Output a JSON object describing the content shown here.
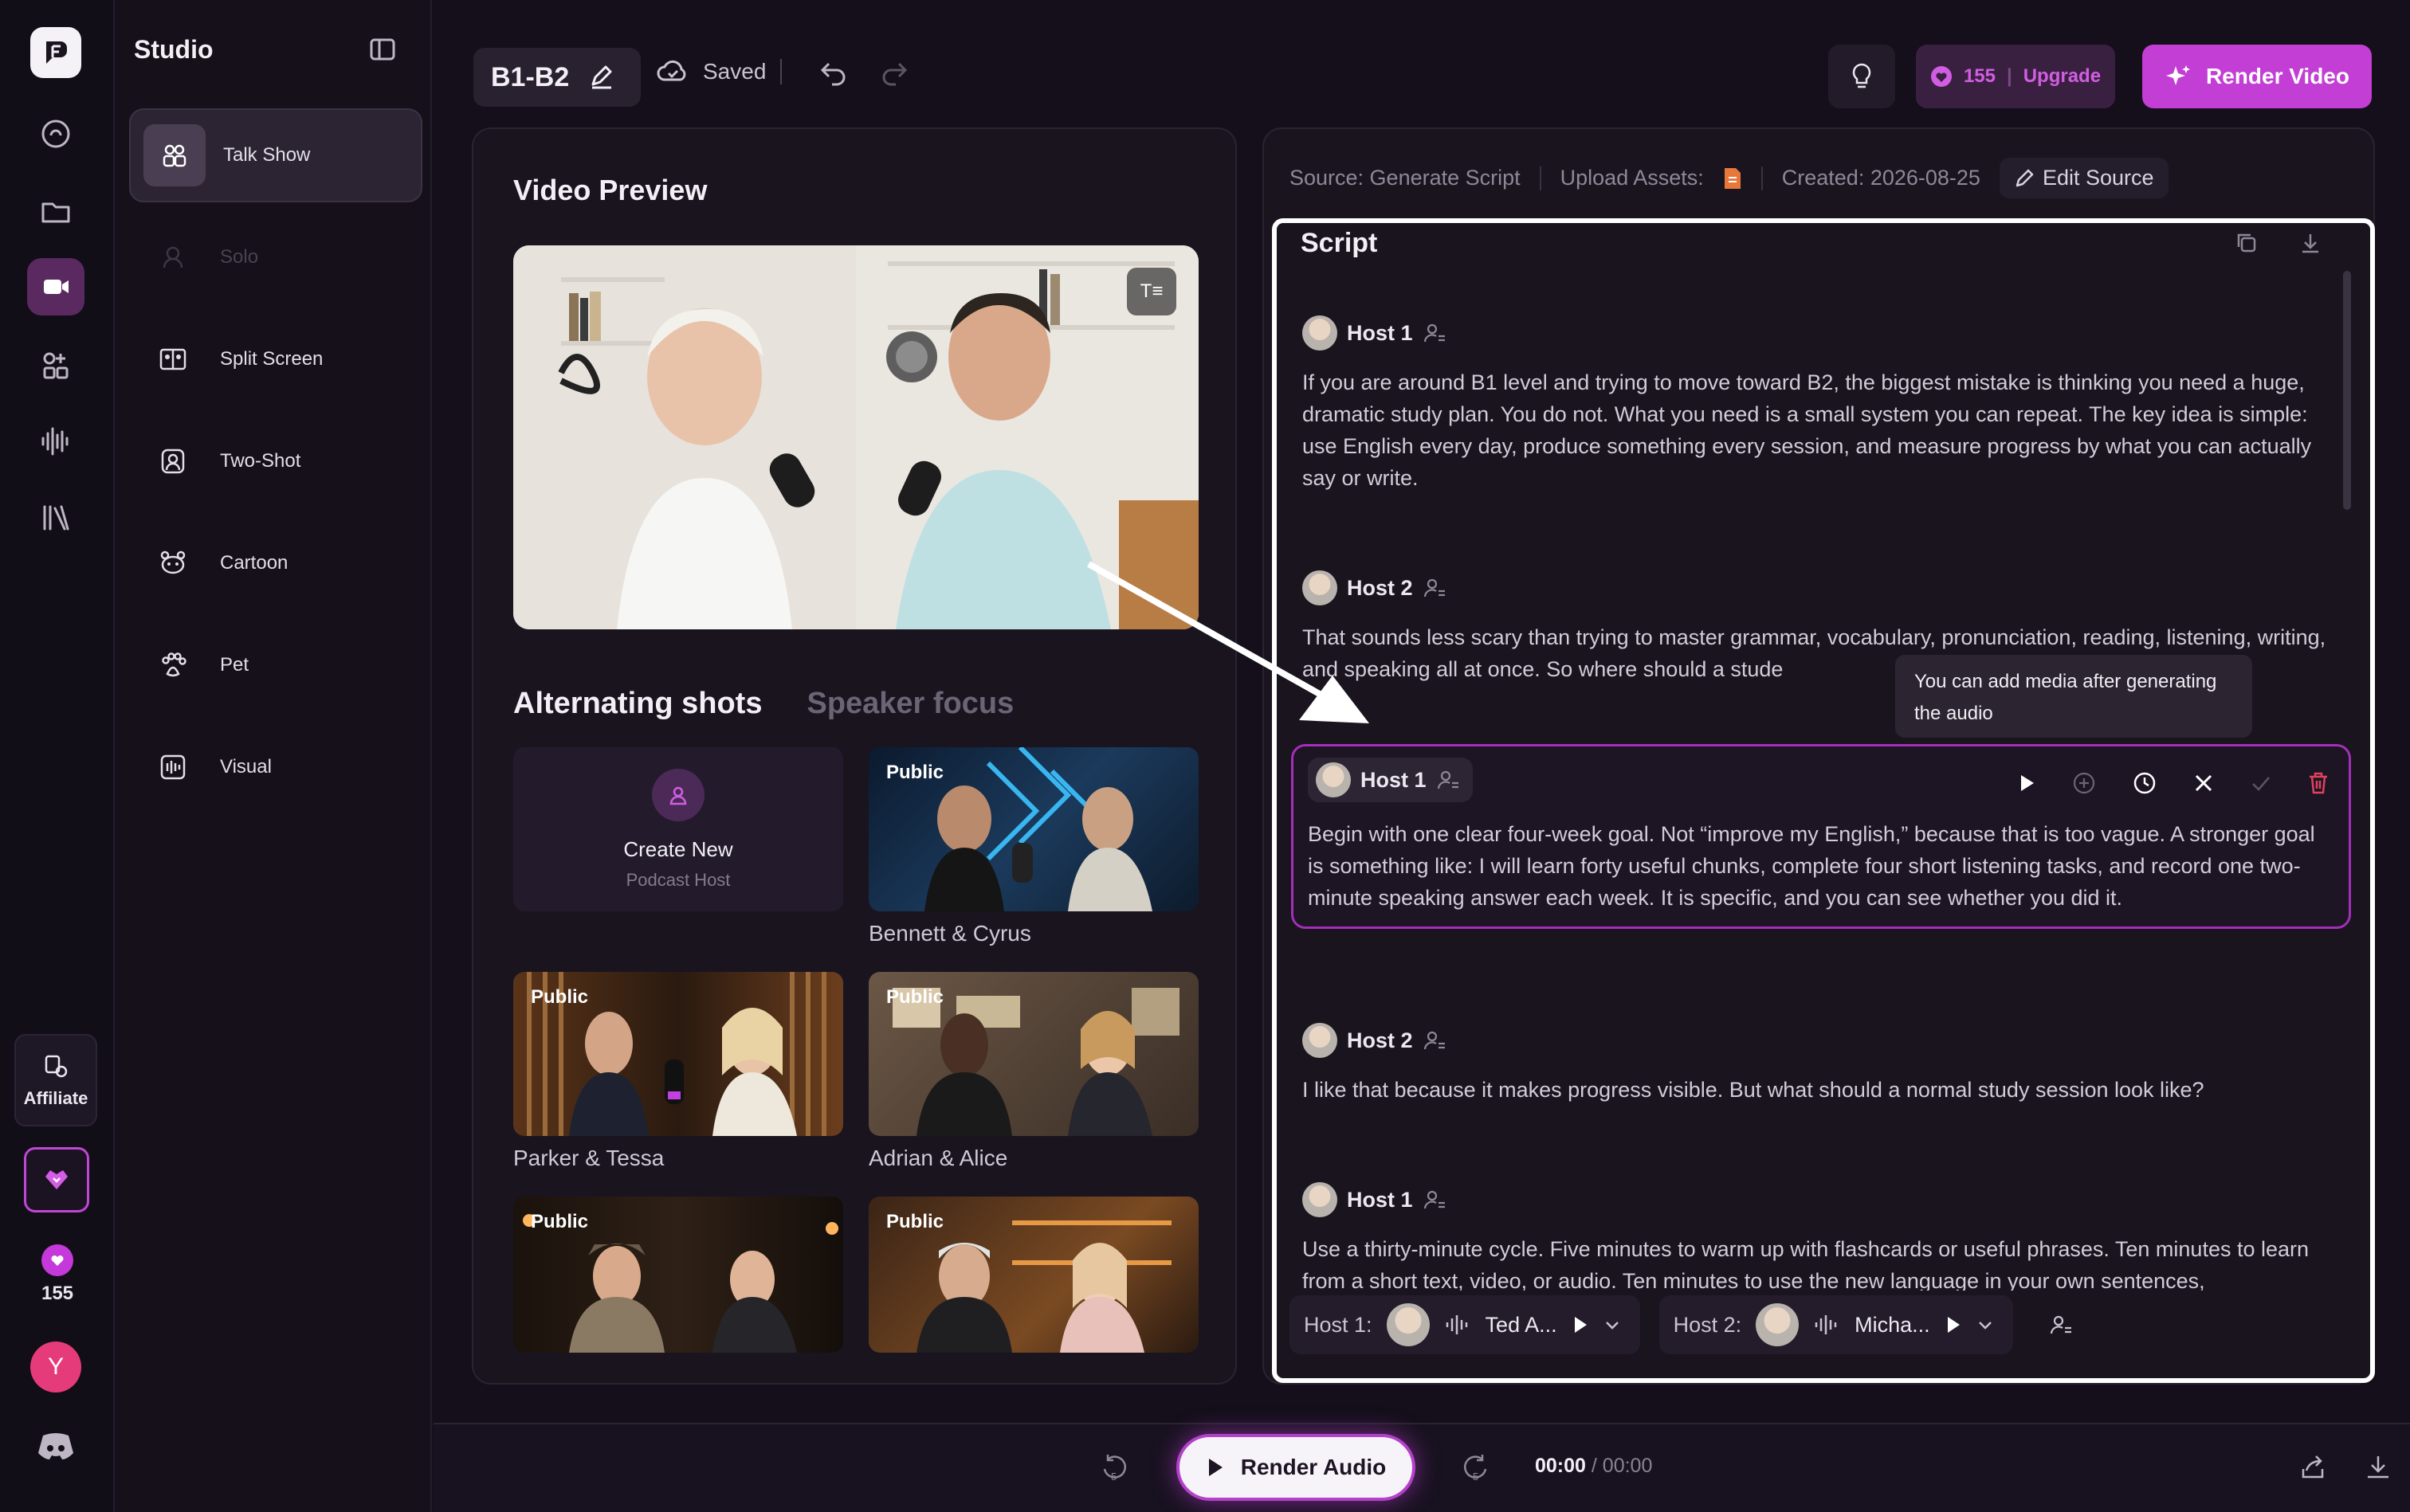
{
  "sidebar": {
    "title": "Studio",
    "items": [
      {
        "label": "Talk Show",
        "icon": "group-icon",
        "active": true
      },
      {
        "label": "Solo",
        "icon": "solo-icon",
        "disabled": true
      },
      {
        "label": "Split Screen",
        "icon": "split-screen-icon"
      },
      {
        "label": "Two-Shot",
        "icon": "two-shot-icon"
      },
      {
        "label": "Cartoon",
        "icon": "cartoon-icon"
      },
      {
        "label": "Pet",
        "icon": "paw-icon"
      },
      {
        "label": "Visual",
        "icon": "visual-icon"
      }
    ]
  },
  "rail": {
    "affiliate_label": "Affiliate",
    "credits": "155",
    "avatar_initial": "Y"
  },
  "topbar": {
    "project_name": "B1-B2",
    "saved_label": "Saved",
    "credits": "155",
    "upgrade_label": "Upgrade",
    "render_video_label": "Render Video"
  },
  "preview": {
    "title": "Video Preview",
    "tabs": [
      "Alternating shots",
      "Speaker focus"
    ],
    "create_new": {
      "title": "Create New",
      "subtitle": "Podcast Host"
    },
    "badge": "Public",
    "hosts": [
      "Bennett & Cyrus",
      "Parker & Tessa",
      "Adrian & Alice"
    ]
  },
  "script": {
    "source_label": "Source: Generate Script",
    "upload_label": "Upload Assets:",
    "created_label": "Created: 2026-08-25",
    "edit_source_label": "Edit Source",
    "title": "Script",
    "tooltip": "You can add media after generating the audio",
    "turns": [
      {
        "speaker": "Host 1",
        "text": "If you are around B1 level and trying to move toward B2, the biggest mistake is thinking you need a huge, dramatic study plan. You do not. What you need is a small system you can repeat. The key idea is simple: use English every day, produce something every session, and measure progress by what you can actually say or write."
      },
      {
        "speaker": "Host 2",
        "text": "That sounds less scary than trying to master grammar, vocabulary, pronunciation, reading, listening, writing, and speaking all at once. So where should a stude"
      },
      {
        "speaker": "Host 1",
        "text": "Begin with one clear four-week goal. Not “improve my English,” because that is too vague. A stronger goal is something like: I will learn forty useful chunks, complete four short listening tasks, and record one two-minute speaking answer each week. It is specific, and you can see whether you did it."
      },
      {
        "speaker": "Host 2",
        "text": "I like that because it makes progress visible. But what should a normal study session look like?"
      },
      {
        "speaker": "Host 1",
        "text": "Use a thirty-minute cycle. Five minutes to warm up with flashcards or useful phrases. Ten minutes to learn from a short text, video, or audio. Ten minutes to use the new language in your own sentences,"
      }
    ],
    "voices": [
      {
        "label": "Host 1:",
        "voice": "Ted A..."
      },
      {
        "label": "Host 2:",
        "voice": "Micha..."
      }
    ]
  },
  "player": {
    "render_audio_label": "Render Audio",
    "current_time": "00:00",
    "total_time": "/ 00:00"
  },
  "colors": {
    "accent": "#c23ed4",
    "background": "#140f1b",
    "panel": "#1a141f"
  }
}
